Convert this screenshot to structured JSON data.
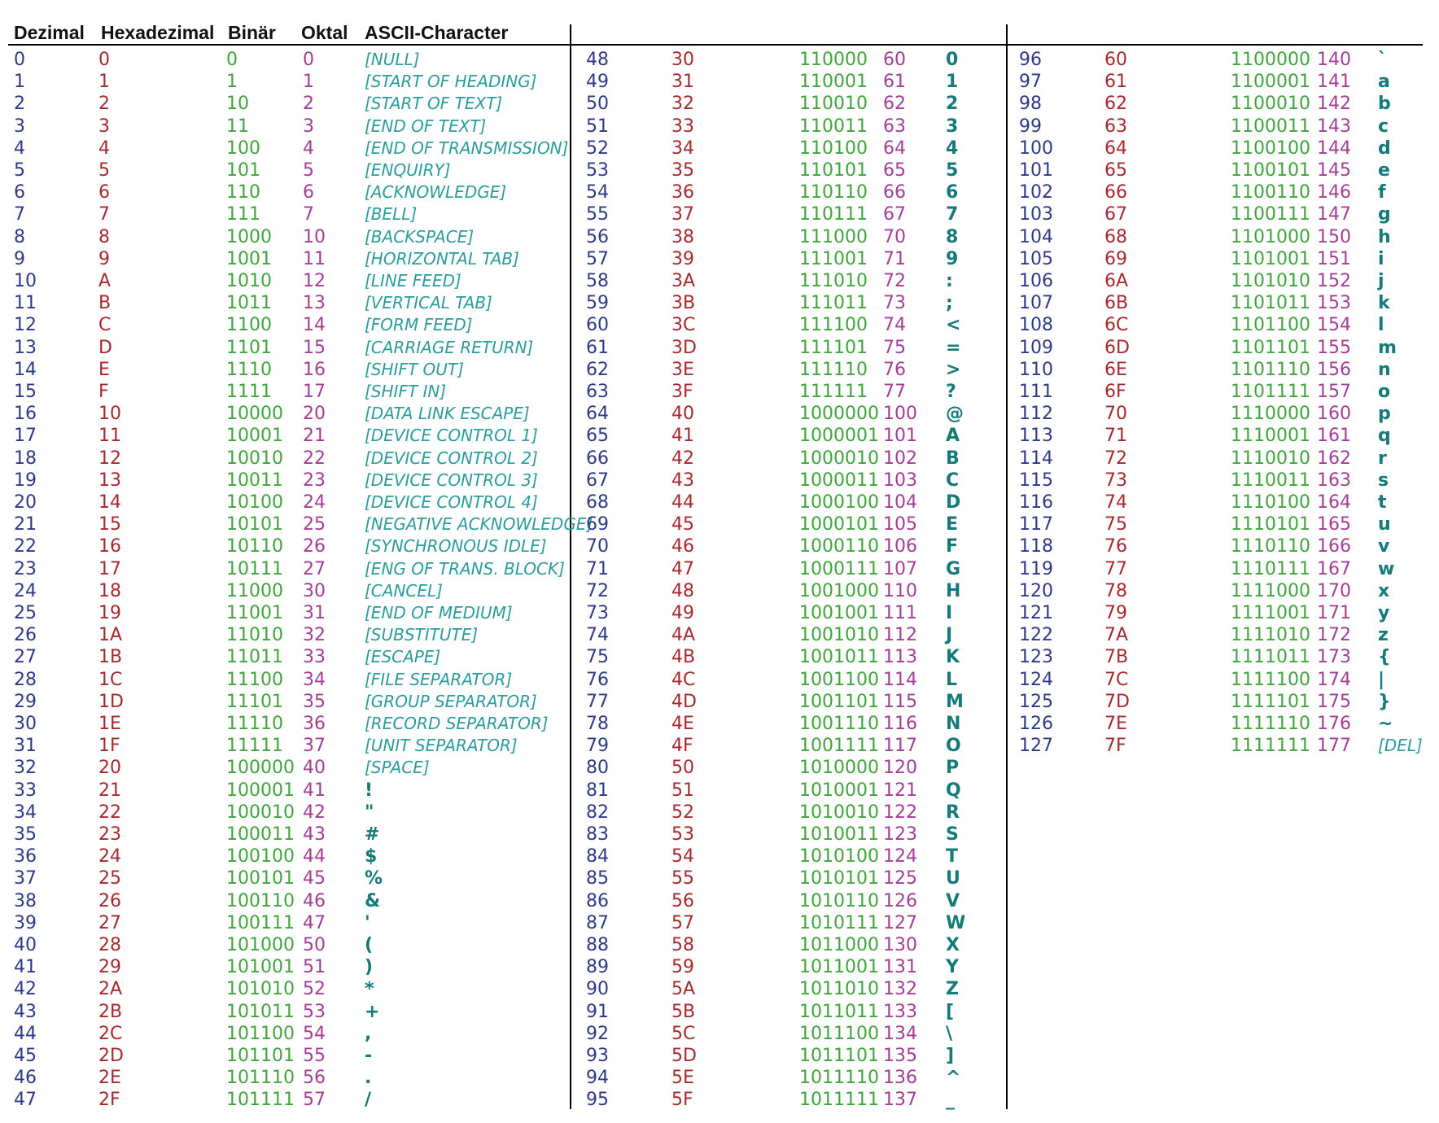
{
  "headers": {
    "dezimal": "Dezimal",
    "hexadezimal": "Hexadezimal",
    "binaer": "Binär",
    "oktal": "Oktal",
    "ascii": "ASCII-Character"
  },
  "colors": {
    "decimal": "#2e3a87",
    "hex": "#a8282e",
    "binary": "#3fa53c",
    "octal": "#a53c96",
    "character": "#157a7a"
  },
  "rows": [
    {
      "dec": "0",
      "hex": "0",
      "bin": "0",
      "oct": "0",
      "chr": "[NULL]",
      "ctl": true
    },
    {
      "dec": "1",
      "hex": "1",
      "bin": "1",
      "oct": "1",
      "chr": "[START OF HEADING]",
      "ctl": true
    },
    {
      "dec": "2",
      "hex": "2",
      "bin": "10",
      "oct": "2",
      "chr": "[START OF TEXT]",
      "ctl": true
    },
    {
      "dec": "3",
      "hex": "3",
      "bin": "11",
      "oct": "3",
      "chr": "[END OF TEXT]",
      "ctl": true
    },
    {
      "dec": "4",
      "hex": "4",
      "bin": "100",
      "oct": "4",
      "chr": "[END OF TRANSMISSION]",
      "ctl": true
    },
    {
      "dec": "5",
      "hex": "5",
      "bin": "101",
      "oct": "5",
      "chr": "[ENQUIRY]",
      "ctl": true
    },
    {
      "dec": "6",
      "hex": "6",
      "bin": "110",
      "oct": "6",
      "chr": "[ACKNOWLEDGE]",
      "ctl": true
    },
    {
      "dec": "7",
      "hex": "7",
      "bin": "111",
      "oct": "7",
      "chr": "[BELL]",
      "ctl": true
    },
    {
      "dec": "8",
      "hex": "8",
      "bin": "1000",
      "oct": "10",
      "chr": "[BACKSPACE]",
      "ctl": true
    },
    {
      "dec": "9",
      "hex": "9",
      "bin": "1001",
      "oct": "11",
      "chr": "[HORIZONTAL TAB]",
      "ctl": true
    },
    {
      "dec": "10",
      "hex": "A",
      "bin": "1010",
      "oct": "12",
      "chr": "[LINE FEED]",
      "ctl": true
    },
    {
      "dec": "11",
      "hex": "B",
      "bin": "1011",
      "oct": "13",
      "chr": "[VERTICAL TAB]",
      "ctl": true
    },
    {
      "dec": "12",
      "hex": "C",
      "bin": "1100",
      "oct": "14",
      "chr": "[FORM FEED]",
      "ctl": true
    },
    {
      "dec": "13",
      "hex": "D",
      "bin": "1101",
      "oct": "15",
      "chr": "[CARRIAGE RETURN]",
      "ctl": true
    },
    {
      "dec": "14",
      "hex": "E",
      "bin": "1110",
      "oct": "16",
      "chr": "[SHIFT OUT]",
      "ctl": true
    },
    {
      "dec": "15",
      "hex": "F",
      "bin": "1111",
      "oct": "17",
      "chr": "[SHIFT IN]",
      "ctl": true
    },
    {
      "dec": "16",
      "hex": "10",
      "bin": "10000",
      "oct": "20",
      "chr": "[DATA LINK ESCAPE]",
      "ctl": true
    },
    {
      "dec": "17",
      "hex": "11",
      "bin": "10001",
      "oct": "21",
      "chr": "[DEVICE CONTROL 1]",
      "ctl": true
    },
    {
      "dec": "18",
      "hex": "12",
      "bin": "10010",
      "oct": "22",
      "chr": "[DEVICE CONTROL 2]",
      "ctl": true
    },
    {
      "dec": "19",
      "hex": "13",
      "bin": "10011",
      "oct": "23",
      "chr": "[DEVICE CONTROL 3]",
      "ctl": true
    },
    {
      "dec": "20",
      "hex": "14",
      "bin": "10100",
      "oct": "24",
      "chr": "[DEVICE CONTROL 4]",
      "ctl": true
    },
    {
      "dec": "21",
      "hex": "15",
      "bin": "10101",
      "oct": "25",
      "chr": "[NEGATIVE ACKNOWLEDGE]",
      "ctl": true
    },
    {
      "dec": "22",
      "hex": "16",
      "bin": "10110",
      "oct": "26",
      "chr": "[SYNCHRONOUS IDLE]",
      "ctl": true
    },
    {
      "dec": "23",
      "hex": "17",
      "bin": "10111",
      "oct": "27",
      "chr": "[ENG OF TRANS. BLOCK]",
      "ctl": true
    },
    {
      "dec": "24",
      "hex": "18",
      "bin": "11000",
      "oct": "30",
      "chr": "[CANCEL]",
      "ctl": true
    },
    {
      "dec": "25",
      "hex": "19",
      "bin": "11001",
      "oct": "31",
      "chr": "[END OF MEDIUM]",
      "ctl": true
    },
    {
      "dec": "26",
      "hex": "1A",
      "bin": "11010",
      "oct": "32",
      "chr": "[SUBSTITUTE]",
      "ctl": true
    },
    {
      "dec": "27",
      "hex": "1B",
      "bin": "11011",
      "oct": "33",
      "chr": "[ESCAPE]",
      "ctl": true
    },
    {
      "dec": "28",
      "hex": "1C",
      "bin": "11100",
      "oct": "34",
      "chr": "[FILE SEPARATOR]",
      "ctl": true
    },
    {
      "dec": "29",
      "hex": "1D",
      "bin": "11101",
      "oct": "35",
      "chr": "[GROUP SEPARATOR]",
      "ctl": true
    },
    {
      "dec": "30",
      "hex": "1E",
      "bin": "11110",
      "oct": "36",
      "chr": "[RECORD SEPARATOR]",
      "ctl": true
    },
    {
      "dec": "31",
      "hex": "1F",
      "bin": "11111",
      "oct": "37",
      "chr": "[UNIT SEPARATOR]",
      "ctl": true
    },
    {
      "dec": "32",
      "hex": "20",
      "bin": "100000",
      "oct": "40",
      "chr": "[SPACE]",
      "ctl": true
    },
    {
      "dec": "33",
      "hex": "21",
      "bin": "100001",
      "oct": "41",
      "chr": "!"
    },
    {
      "dec": "34",
      "hex": "22",
      "bin": "100010",
      "oct": "42",
      "chr": "\""
    },
    {
      "dec": "35",
      "hex": "23",
      "bin": "100011",
      "oct": "43",
      "chr": "#"
    },
    {
      "dec": "36",
      "hex": "24",
      "bin": "100100",
      "oct": "44",
      "chr": "$"
    },
    {
      "dec": "37",
      "hex": "25",
      "bin": "100101",
      "oct": "45",
      "chr": "%"
    },
    {
      "dec": "38",
      "hex": "26",
      "bin": "100110",
      "oct": "46",
      "chr": "&"
    },
    {
      "dec": "39",
      "hex": "27",
      "bin": "100111",
      "oct": "47",
      "chr": "'"
    },
    {
      "dec": "40",
      "hex": "28",
      "bin": "101000",
      "oct": "50",
      "chr": "("
    },
    {
      "dec": "41",
      "hex": "29",
      "bin": "101001",
      "oct": "51",
      "chr": ")"
    },
    {
      "dec": "42",
      "hex": "2A",
      "bin": "101010",
      "oct": "52",
      "chr": "*"
    },
    {
      "dec": "43",
      "hex": "2B",
      "bin": "101011",
      "oct": "53",
      "chr": "+"
    },
    {
      "dec": "44",
      "hex": "2C",
      "bin": "101100",
      "oct": "54",
      "chr": ","
    },
    {
      "dec": "45",
      "hex": "2D",
      "bin": "101101",
      "oct": "55",
      "chr": "-"
    },
    {
      "dec": "46",
      "hex": "2E",
      "bin": "101110",
      "oct": "56",
      "chr": "."
    },
    {
      "dec": "47",
      "hex": "2F",
      "bin": "101111",
      "oct": "57",
      "chr": "/"
    },
    {
      "dec": "48",
      "hex": "30",
      "bin": "110000",
      "oct": "60",
      "chr": "0"
    },
    {
      "dec": "49",
      "hex": "31",
      "bin": "110001",
      "oct": "61",
      "chr": "1"
    },
    {
      "dec": "50",
      "hex": "32",
      "bin": "110010",
      "oct": "62",
      "chr": "2"
    },
    {
      "dec": "51",
      "hex": "33",
      "bin": "110011",
      "oct": "63",
      "chr": "3"
    },
    {
      "dec": "52",
      "hex": "34",
      "bin": "110100",
      "oct": "64",
      "chr": "4"
    },
    {
      "dec": "53",
      "hex": "35",
      "bin": "110101",
      "oct": "65",
      "chr": "5"
    },
    {
      "dec": "54",
      "hex": "36",
      "bin": "110110",
      "oct": "66",
      "chr": "6"
    },
    {
      "dec": "55",
      "hex": "37",
      "bin": "110111",
      "oct": "67",
      "chr": "7"
    },
    {
      "dec": "56",
      "hex": "38",
      "bin": "111000",
      "oct": "70",
      "chr": "8"
    },
    {
      "dec": "57",
      "hex": "39",
      "bin": "111001",
      "oct": "71",
      "chr": "9"
    },
    {
      "dec": "58",
      "hex": "3A",
      "bin": "111010",
      "oct": "72",
      "chr": ":"
    },
    {
      "dec": "59",
      "hex": "3B",
      "bin": "111011",
      "oct": "73",
      "chr": ";"
    },
    {
      "dec": "60",
      "hex": "3C",
      "bin": "111100",
      "oct": "74",
      "chr": "<"
    },
    {
      "dec": "61",
      "hex": "3D",
      "bin": "111101",
      "oct": "75",
      "chr": "="
    },
    {
      "dec": "62",
      "hex": "3E",
      "bin": "111110",
      "oct": "76",
      "chr": ">"
    },
    {
      "dec": "63",
      "hex": "3F",
      "bin": "111111",
      "oct": "77",
      "chr": "?"
    },
    {
      "dec": "64",
      "hex": "40",
      "bin": "1000000",
      "oct": "100",
      "chr": "@"
    },
    {
      "dec": "65",
      "hex": "41",
      "bin": "1000001",
      "oct": "101",
      "chr": "A"
    },
    {
      "dec": "66",
      "hex": "42",
      "bin": "1000010",
      "oct": "102",
      "chr": "B"
    },
    {
      "dec": "67",
      "hex": "43",
      "bin": "1000011",
      "oct": "103",
      "chr": "C"
    },
    {
      "dec": "68",
      "hex": "44",
      "bin": "1000100",
      "oct": "104",
      "chr": "D"
    },
    {
      "dec": "69",
      "hex": "45",
      "bin": "1000101",
      "oct": "105",
      "chr": "E"
    },
    {
      "dec": "70",
      "hex": "46",
      "bin": "1000110",
      "oct": "106",
      "chr": "F"
    },
    {
      "dec": "71",
      "hex": "47",
      "bin": "1000111",
      "oct": "107",
      "chr": "G"
    },
    {
      "dec": "72",
      "hex": "48",
      "bin": "1001000",
      "oct": "110",
      "chr": "H"
    },
    {
      "dec": "73",
      "hex": "49",
      "bin": "1001001",
      "oct": "111",
      "chr": "I"
    },
    {
      "dec": "74",
      "hex": "4A",
      "bin": "1001010",
      "oct": "112",
      "chr": "J"
    },
    {
      "dec": "75",
      "hex": "4B",
      "bin": "1001011",
      "oct": "113",
      "chr": "K"
    },
    {
      "dec": "76",
      "hex": "4C",
      "bin": "1001100",
      "oct": "114",
      "chr": "L"
    },
    {
      "dec": "77",
      "hex": "4D",
      "bin": "1001101",
      "oct": "115",
      "chr": "M"
    },
    {
      "dec": "78",
      "hex": "4E",
      "bin": "1001110",
      "oct": "116",
      "chr": "N"
    },
    {
      "dec": "79",
      "hex": "4F",
      "bin": "1001111",
      "oct": "117",
      "chr": "O"
    },
    {
      "dec": "80",
      "hex": "50",
      "bin": "1010000",
      "oct": "120",
      "chr": "P"
    },
    {
      "dec": "81",
      "hex": "51",
      "bin": "1010001",
      "oct": "121",
      "chr": "Q"
    },
    {
      "dec": "82",
      "hex": "52",
      "bin": "1010010",
      "oct": "122",
      "chr": "R"
    },
    {
      "dec": "83",
      "hex": "53",
      "bin": "1010011",
      "oct": "123",
      "chr": "S"
    },
    {
      "dec": "84",
      "hex": "54",
      "bin": "1010100",
      "oct": "124",
      "chr": "T"
    },
    {
      "dec": "85",
      "hex": "55",
      "bin": "1010101",
      "oct": "125",
      "chr": "U"
    },
    {
      "dec": "86",
      "hex": "56",
      "bin": "1010110",
      "oct": "126",
      "chr": "V"
    },
    {
      "dec": "87",
      "hex": "57",
      "bin": "1010111",
      "oct": "127",
      "chr": "W"
    },
    {
      "dec": "88",
      "hex": "58",
      "bin": "1011000",
      "oct": "130",
      "chr": "X"
    },
    {
      "dec": "89",
      "hex": "59",
      "bin": "1011001",
      "oct": "131",
      "chr": "Y"
    },
    {
      "dec": "90",
      "hex": "5A",
      "bin": "1011010",
      "oct": "132",
      "chr": "Z"
    },
    {
      "dec": "91",
      "hex": "5B",
      "bin": "1011011",
      "oct": "133",
      "chr": "["
    },
    {
      "dec": "92",
      "hex": "5C",
      "bin": "1011100",
      "oct": "134",
      "chr": "\\"
    },
    {
      "dec": "93",
      "hex": "5D",
      "bin": "1011101",
      "oct": "135",
      "chr": "]"
    },
    {
      "dec": "94",
      "hex": "5E",
      "bin": "1011110",
      "oct": "136",
      "chr": "^"
    },
    {
      "dec": "95",
      "hex": "5F",
      "bin": "1011111",
      "oct": "137",
      "chr": "_"
    },
    {
      "dec": "96",
      "hex": "60",
      "bin": "1100000",
      "oct": "140",
      "chr": "`"
    },
    {
      "dec": "97",
      "hex": "61",
      "bin": "1100001",
      "oct": "141",
      "chr": "a"
    },
    {
      "dec": "98",
      "hex": "62",
      "bin": "1100010",
      "oct": "142",
      "chr": "b"
    },
    {
      "dec": "99",
      "hex": "63",
      "bin": "1100011",
      "oct": "143",
      "chr": "c"
    },
    {
      "dec": "100",
      "hex": "64",
      "bin": "1100100",
      "oct": "144",
      "chr": "d"
    },
    {
      "dec": "101",
      "hex": "65",
      "bin": "1100101",
      "oct": "145",
      "chr": "e"
    },
    {
      "dec": "102",
      "hex": "66",
      "bin": "1100110",
      "oct": "146",
      "chr": "f"
    },
    {
      "dec": "103",
      "hex": "67",
      "bin": "1100111",
      "oct": "147",
      "chr": "g"
    },
    {
      "dec": "104",
      "hex": "68",
      "bin": "1101000",
      "oct": "150",
      "chr": "h"
    },
    {
      "dec": "105",
      "hex": "69",
      "bin": "1101001",
      "oct": "151",
      "chr": "i"
    },
    {
      "dec": "106",
      "hex": "6A",
      "bin": "1101010",
      "oct": "152",
      "chr": "j"
    },
    {
      "dec": "107",
      "hex": "6B",
      "bin": "1101011",
      "oct": "153",
      "chr": "k"
    },
    {
      "dec": "108",
      "hex": "6C",
      "bin": "1101100",
      "oct": "154",
      "chr": "l"
    },
    {
      "dec": "109",
      "hex": "6D",
      "bin": "1101101",
      "oct": "155",
      "chr": "m"
    },
    {
      "dec": "110",
      "hex": "6E",
      "bin": "1101110",
      "oct": "156",
      "chr": "n"
    },
    {
      "dec": "111",
      "hex": "6F",
      "bin": "1101111",
      "oct": "157",
      "chr": "o"
    },
    {
      "dec": "112",
      "hex": "70",
      "bin": "1110000",
      "oct": "160",
      "chr": "p"
    },
    {
      "dec": "113",
      "hex": "71",
      "bin": "1110001",
      "oct": "161",
      "chr": "q"
    },
    {
      "dec": "114",
      "hex": "72",
      "bin": "1110010",
      "oct": "162",
      "chr": "r"
    },
    {
      "dec": "115",
      "hex": "73",
      "bin": "1110011",
      "oct": "163",
      "chr": "s"
    },
    {
      "dec": "116",
      "hex": "74",
      "bin": "1110100",
      "oct": "164",
      "chr": "t"
    },
    {
      "dec": "117",
      "hex": "75",
      "bin": "1110101",
      "oct": "165",
      "chr": "u"
    },
    {
      "dec": "118",
      "hex": "76",
      "bin": "1110110",
      "oct": "166",
      "chr": "v"
    },
    {
      "dec": "119",
      "hex": "77",
      "bin": "1110111",
      "oct": "167",
      "chr": "w"
    },
    {
      "dec": "120",
      "hex": "78",
      "bin": "1111000",
      "oct": "170",
      "chr": "x"
    },
    {
      "dec": "121",
      "hex": "79",
      "bin": "1111001",
      "oct": "171",
      "chr": "y"
    },
    {
      "dec": "122",
      "hex": "7A",
      "bin": "1111010",
      "oct": "172",
      "chr": "z"
    },
    {
      "dec": "123",
      "hex": "7B",
      "bin": "1111011",
      "oct": "173",
      "chr": "{"
    },
    {
      "dec": "124",
      "hex": "7C",
      "bin": "1111100",
      "oct": "174",
      "chr": "|"
    },
    {
      "dec": "125",
      "hex": "7D",
      "bin": "1111101",
      "oct": "175",
      "chr": "}"
    },
    {
      "dec": "126",
      "hex": "7E",
      "bin": "1111110",
      "oct": "176",
      "chr": "~"
    },
    {
      "dec": "127",
      "hex": "7F",
      "bin": "1111111",
      "oct": "177",
      "chr": "[DEL]",
      "ctl": true
    }
  ]
}
